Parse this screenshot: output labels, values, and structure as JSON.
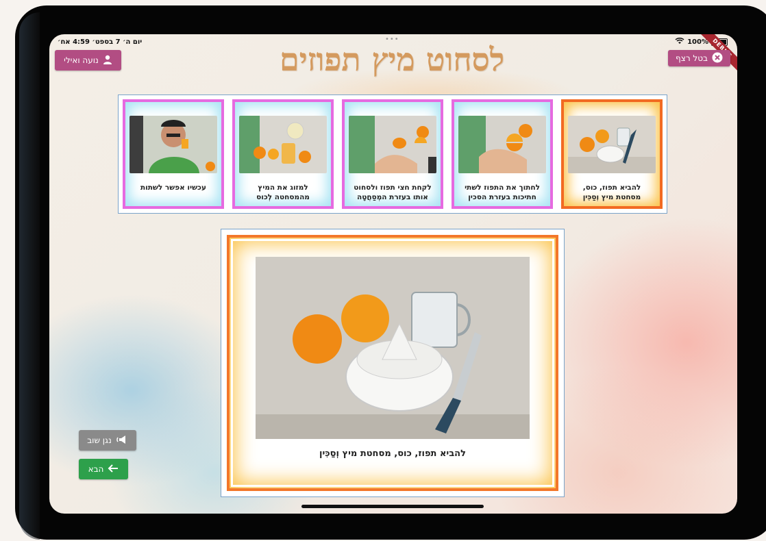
{
  "status_bar": {
    "datetime": "יום ה׳ 7 בספט׳ 4:59 אח׳",
    "dots": "•••",
    "battery": "100%",
    "debug": "DEBUG"
  },
  "header": {
    "title": "לסחוט מיץ תפוזים",
    "user_button": "נועה ואילי",
    "cancel_button": "בטל רצף"
  },
  "steps": [
    {
      "caption": "להביא תפוז, כוס, מסחטת מיץ וְסַכִּין",
      "selected": true
    },
    {
      "caption": "לחתוך את התפוז לשתי חתיכות בעזרת הסכין",
      "selected": false
    },
    {
      "caption": "לקחת חצי תפוז ולסחוט אותו בעזרת המְסַחֲטָה",
      "selected": false
    },
    {
      "caption": "למזוג את המיץ מהמסחטה לְכוס",
      "selected": false
    },
    {
      "caption": "עכשיו אפשר לשתות",
      "selected": false
    }
  ],
  "main_step": {
    "caption": "להביא תפוז, כוס, מסחטת מיץ וְסַכִּין"
  },
  "controls": {
    "replay_button": "נגן שוב",
    "next_button": "הבא"
  },
  "colors": {
    "accent_pink": "#b24d83",
    "next_green": "#2da04b",
    "replay_gray": "#8a8a8a",
    "selected_frame": "#f26a22",
    "card_frame": "#e66ae0"
  }
}
